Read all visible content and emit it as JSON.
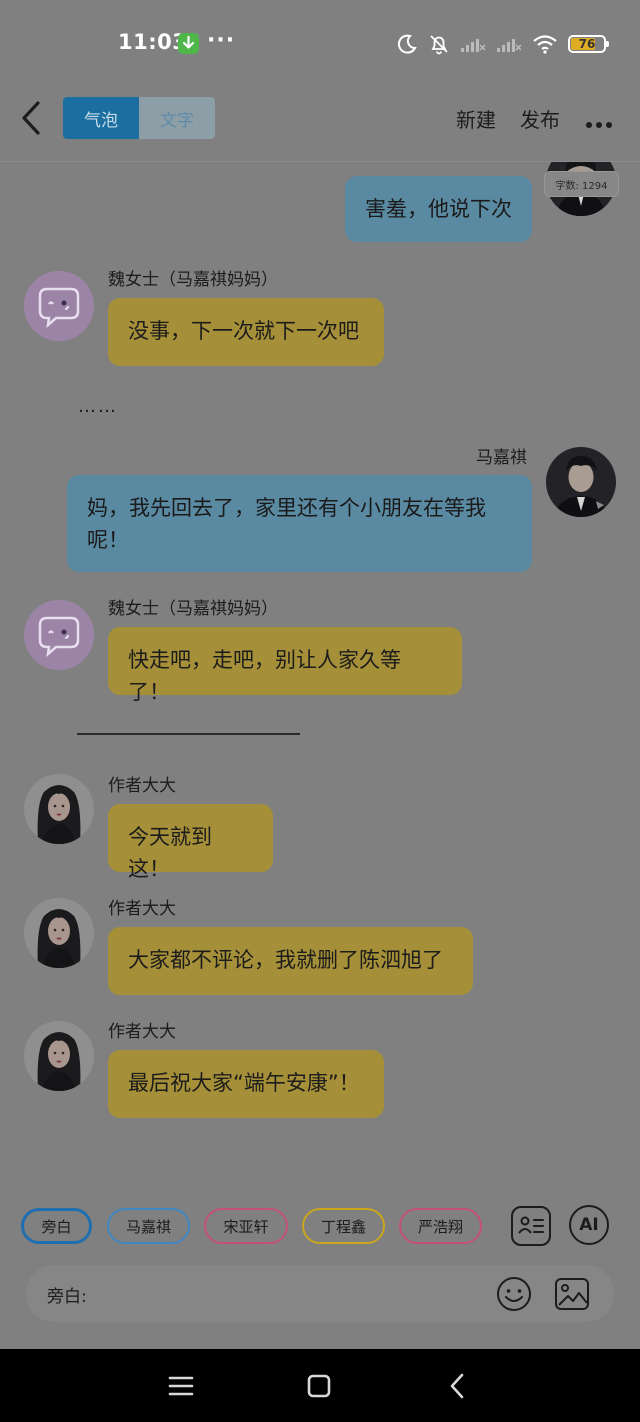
{
  "status": {
    "time": "11:03",
    "overflow": "···",
    "battery": "76",
    "icons": [
      "download-icon",
      "moon-icon",
      "bell-off-icon",
      "signal-icon",
      "signal-icon",
      "wifi-icon",
      "battery-icon"
    ]
  },
  "header": {
    "back_icon": "back-chevron-icon",
    "tabs": [
      {
        "label": "气泡",
        "active": true
      },
      {
        "label": "文字",
        "active": false
      }
    ],
    "new_label": "新建",
    "publish_label": "发布",
    "more_icon": "more-dots-icon"
  },
  "chat": {
    "word_count": "字数: 1294",
    "messages": [
      {
        "side": "right",
        "sender": "",
        "text": "害羞，他说下次",
        "color": "blue"
      },
      {
        "side": "left",
        "sender": "魏女士（马嘉祺妈妈）",
        "text": "没事，下一次就下一次吧",
        "color": "yellow",
        "avatar": "default-bubble-avatar"
      },
      {
        "type": "narration",
        "text": "……"
      },
      {
        "side": "right",
        "sender": "马嘉祺",
        "text": "妈，我先回去了，家里还有个小朋友在等我呢！",
        "color": "blue",
        "avatar": "boy-avatar"
      },
      {
        "side": "left",
        "sender": "魏女士（马嘉祺妈妈）",
        "text": "快走吧，走吧，别让人家久等了！",
        "color": "yellow",
        "avatar": "default-bubble-avatar"
      },
      {
        "type": "divider"
      },
      {
        "side": "left",
        "sender": "作者大大",
        "text": "今天就到这！",
        "color": "yellow",
        "avatar": "girl-avatar"
      },
      {
        "side": "left",
        "sender": "作者大大",
        "text": "大家都不评论，我就删了陈泗旭了",
        "color": "yellow",
        "avatar": "girl-avatar"
      },
      {
        "side": "left",
        "sender": "作者大大",
        "text": "最后祝大家“端午安康”！",
        "color": "yellow",
        "avatar": "girl-avatar"
      }
    ]
  },
  "characters": [
    {
      "label": "旁白",
      "color": "#1f6fb0",
      "selected": true
    },
    {
      "label": "马嘉祺",
      "color": "#3f86c2",
      "selected": false
    },
    {
      "label": "宋亚轩",
      "color": "#c4507a",
      "selected": false
    },
    {
      "label": "丁程鑫",
      "color": "#caa51e",
      "selected": false
    },
    {
      "label": "严浩翔",
      "color": "#c4507a",
      "selected": false
    }
  ],
  "tools": {
    "card_icon": "profile-card-icon",
    "ai_label": "AI"
  },
  "input": {
    "label": "旁白:",
    "emoji_icon": "emoji-icon",
    "image_icon": "image-icon"
  },
  "nav": {
    "icons": [
      "menu-icon",
      "home-square-icon",
      "back-triangle-icon"
    ]
  },
  "colors": {
    "bubble_blue": "#5a8aa2",
    "bubble_yellow": "#a58f38",
    "accent": "#1a6fa0",
    "background": "#808080"
  }
}
